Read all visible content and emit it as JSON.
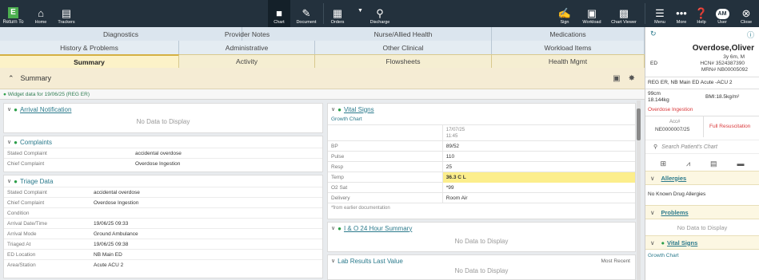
{
  "topbar": {
    "return_to": "Return To",
    "home": "Home",
    "trackers": "Trackers",
    "chart": "Chart",
    "document": "Document",
    "orders": "Orders",
    "discharge": "Discharge",
    "sign": "Sign",
    "workload": "Workload",
    "chart_viewer": "Chart Viewer",
    "menu": "Menu",
    "more": "More",
    "help": "Help",
    "user": "User",
    "user_initials": "AM",
    "close": "Close"
  },
  "tabs": {
    "row1": [
      "Diagnostics",
      "Provider Notes",
      "Nurse/Allied Health",
      "Medications"
    ],
    "row2": [
      "History & Problems",
      "Administrative",
      "Other Clinical",
      "Workload Items"
    ],
    "row3": [
      "Summary",
      "Activity",
      "Flowsheets",
      "Health Mgmt"
    ]
  },
  "summary_bar": {
    "title": "Summary"
  },
  "widget_data": "Widget data for 19/06/25 (REG ER)",
  "arrival": {
    "title": "Arrival Notification",
    "nodata": "No Data to Display"
  },
  "complaints": {
    "title": "Complaints",
    "rows": [
      {
        "k": "Stated Complaint",
        "v": "accidental overdose"
      },
      {
        "k": "Chief Complaint",
        "v": "Overdose Ingestion"
      }
    ]
  },
  "triage": {
    "title": "Triage Data",
    "rows": [
      {
        "k": "Stated Complaint",
        "v": "accidental overdose"
      },
      {
        "k": "Chief Complaint",
        "v": "Overdose Ingestion"
      },
      {
        "k": "Condition",
        "v": ""
      },
      {
        "k": "Arrival Date/Time",
        "v": "19/06/25 09:33"
      },
      {
        "k": "Arrival Mode",
        "v": "Ground Ambulance"
      },
      {
        "k": "Triaged At",
        "v": "19/06/25 09:38"
      },
      {
        "k": "ED Location",
        "v": "NB Main ED"
      },
      {
        "k": "Area/Station",
        "v": "Acute ACU 2"
      }
    ]
  },
  "vitals": {
    "title": "Vital Signs",
    "growth_chart": "Growth Chart",
    "col_date": "17/07/25",
    "col_time": "11:45",
    "rows": [
      {
        "k": "BP",
        "v": "89/52",
        "highlight": false
      },
      {
        "k": "Pulse",
        "v": "110",
        "highlight": false
      },
      {
        "k": "Resp",
        "v": "25",
        "highlight": false
      },
      {
        "k": "Temp",
        "v": "36.3 C L",
        "highlight": true
      },
      {
        "k": "O2 Sat",
        "v": "*99",
        "highlight": false
      },
      {
        "k": "Delivery",
        "v": "Room Air",
        "highlight": false
      }
    ],
    "footnote": "*from earlier documentation"
  },
  "io": {
    "title": "I & O 24 Hour Summary",
    "nodata": "No Data to Display"
  },
  "labs": {
    "title": "Lab Results Last Value",
    "right": "Most Recent",
    "nodata": "No Data to Display"
  },
  "patient": {
    "name": "Overdose,Oliver",
    "age_sex": "3y 6m, M",
    "location_short": "ED",
    "hcn": "HCN# 3524387390",
    "mrn": "MRN# NB00005092",
    "location": "REG ER, NB Main ED  Acute -ACU 2",
    "height": "99cm",
    "weight": "18.144kg",
    "bmi": "BMI:18.5kg/m²",
    "diagnosis": "Overdose Ingestion",
    "acc_label": "Acc#",
    "acc": "NE0000007/25",
    "resus": "Full Resuscitation",
    "search_placeholder": "Search Patient's Chart",
    "allergies_title": "Allergies",
    "allergies_text": "No Known Drug Allergies",
    "problems_title": "Problems",
    "problems_nodata": "No Data to Display",
    "vitals_title": "Vital Signs",
    "growth_chart": "Growth Chart"
  },
  "colors": {
    "topbar": "#23313d",
    "accent_teal": "#2b7a8c",
    "alert_red": "#d9383a",
    "highlight_yellow": "#fcee8c"
  }
}
